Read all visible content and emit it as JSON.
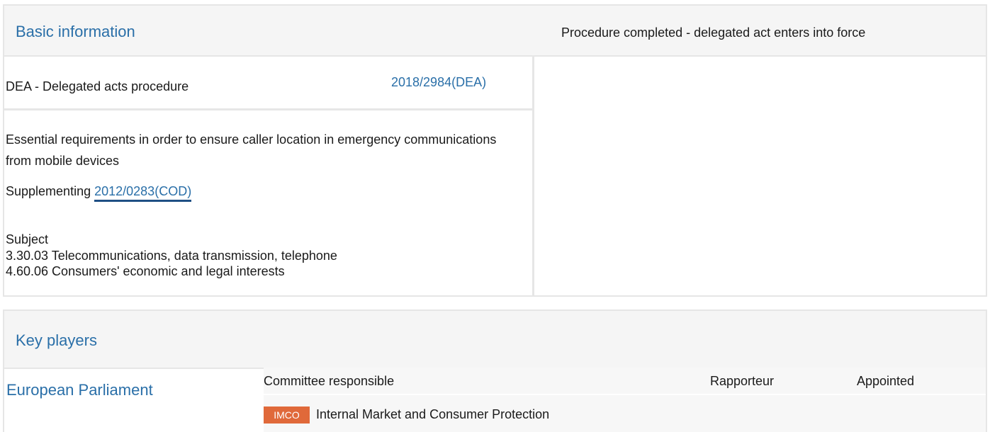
{
  "basic_information": {
    "title": "Basic information",
    "procedure_type": "DEA - Delegated acts procedure",
    "procedure_reference": "2018/2984(DEA)",
    "procedure_title": "Essential requirements in order to ensure caller location in emergency communications from mobile devices",
    "supplementing_label": "Supplementing",
    "supplementing_link": "2012/0283(COD)",
    "subject_label": "Subject",
    "subjects": [
      "3.30.03 Telecommunications, data transmission, telephone",
      "4.60.06 Consumers' economic and legal interests"
    ],
    "status": "Procedure completed - delegated act enters into force"
  },
  "key_players": {
    "title": "Key players",
    "institution": "European Parliament",
    "columns": {
      "committee": "Committee responsible",
      "rapporteur": "Rapporteur",
      "appointed": "Appointed"
    },
    "committee": {
      "code": "IMCO",
      "name": "Internal Market and Consumer Protection"
    }
  },
  "colors": {
    "link": "#2a6fa8",
    "header_bg": "#f5f5f5",
    "border": "#e6e6e6",
    "badge_bg": "#e0693a"
  }
}
